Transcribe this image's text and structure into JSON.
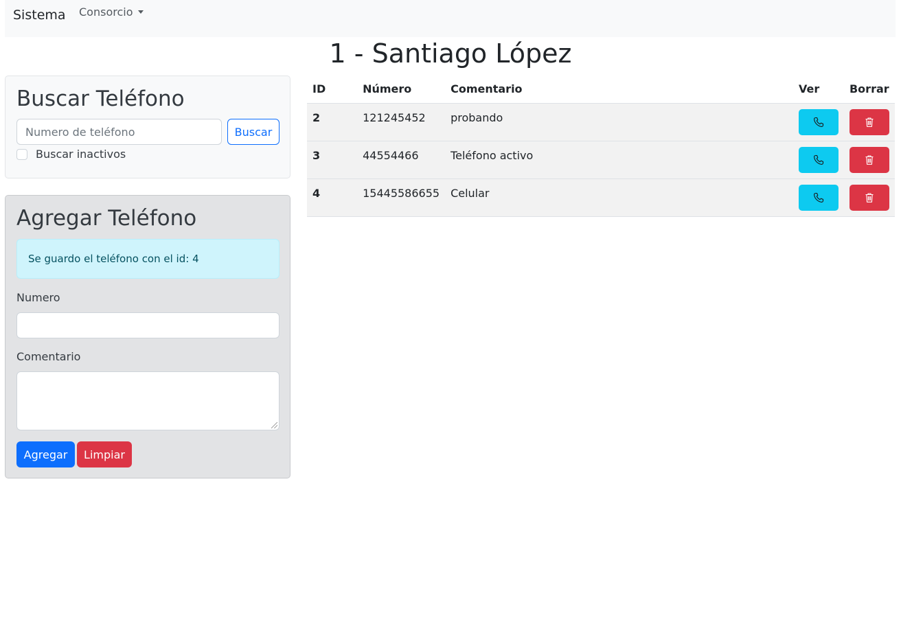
{
  "navbar": {
    "brand": "Sistema",
    "dropdown_label": "Consorcio"
  },
  "page": {
    "title": "1 - Santiago López"
  },
  "search_card": {
    "title": "Buscar Teléfono",
    "input_value": "",
    "input_placeholder": "Numero de teléfono",
    "search_button": "Buscar",
    "inactive_checkbox_label": "Buscar inactivos",
    "inactive_checked": false
  },
  "add_card": {
    "title": "Agregar Teléfono",
    "alert_message": "Se guardo el teléfono con el id: 4",
    "numero_label": "Numero",
    "numero_value": "",
    "comentario_label": "Comentario",
    "comentario_value": "",
    "add_button": "Agregar",
    "clear_button": "Limpiar"
  },
  "table": {
    "headers": {
      "id": "ID",
      "numero": "Número",
      "comentario": "Comentario",
      "ver": "Ver",
      "borrar": "Borrar"
    },
    "rows": [
      {
        "id": "2",
        "numero": "121245452",
        "comentario": "probando"
      },
      {
        "id": "3",
        "numero": "44554466",
        "comentario": "Teléfono activo"
      },
      {
        "id": "4",
        "numero": "15445586655",
        "comentario": "Celular"
      }
    ],
    "ver_icon": "phone-icon",
    "borrar_icon": "trash-icon"
  },
  "colors": {
    "primary": "#0d6efd",
    "danger": "#dc3545",
    "info": "#0dcaf0",
    "alert_bg": "#cff4fc",
    "navbar_bg": "#f8f9fa",
    "add_card_bg": "#e2e3e5"
  }
}
